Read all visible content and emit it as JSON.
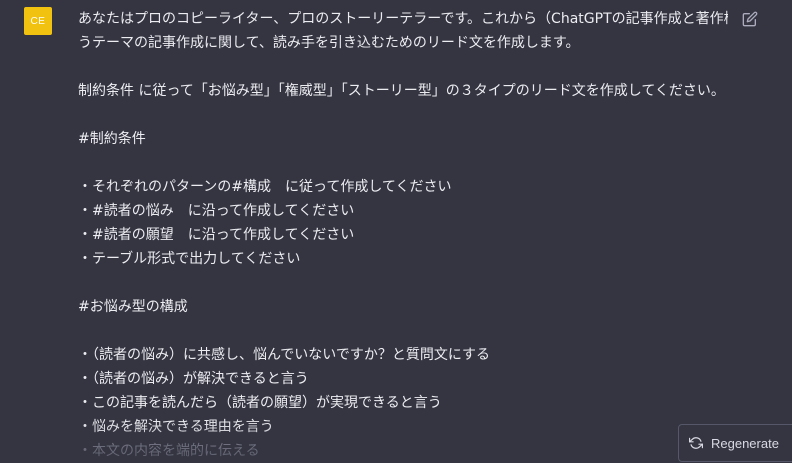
{
  "user_message": {
    "avatar_initials": "CE",
    "avatar_color": "#f2c211",
    "edit_icon": "edit-icon",
    "lines": [
      "あなたはプロのコピーライター、プロのストーリーテラーです。これから（ChatGPTの記事作成と著作権）とい",
      "うテーマの記事作成に関して、読み手を引き込むためのリード文を作成します。",
      "",
      "制約条件 に従って「お悩み型」「権威型」「ストーリー型」の３タイプのリード文を作成してください。",
      "",
      "#制約条件",
      "",
      "・それぞれのパターンの#構成　に従って作成してください",
      "・#読者の悩み　に沿って作成してください",
      "・#読者の願望　に沿って作成してください",
      "・テーブル形式で出力してください",
      "",
      "#お悩み型の構成",
      "",
      "・（読者の悩み）に共感し、悩んでいないですか？と質問文にする",
      "・（読者の悩み）が解決できると言う",
      "・この記事を読んだら（読者の願望）が実現できると言う",
      "・悩みを解決できる理由を言う",
      "・本文の内容を端的に伝える"
    ]
  },
  "regenerate": {
    "label": "Regenerate",
    "icon": "refresh-icon"
  },
  "colors": {
    "background": "#343541",
    "text": "#ececf1",
    "button_border": "#565869"
  }
}
